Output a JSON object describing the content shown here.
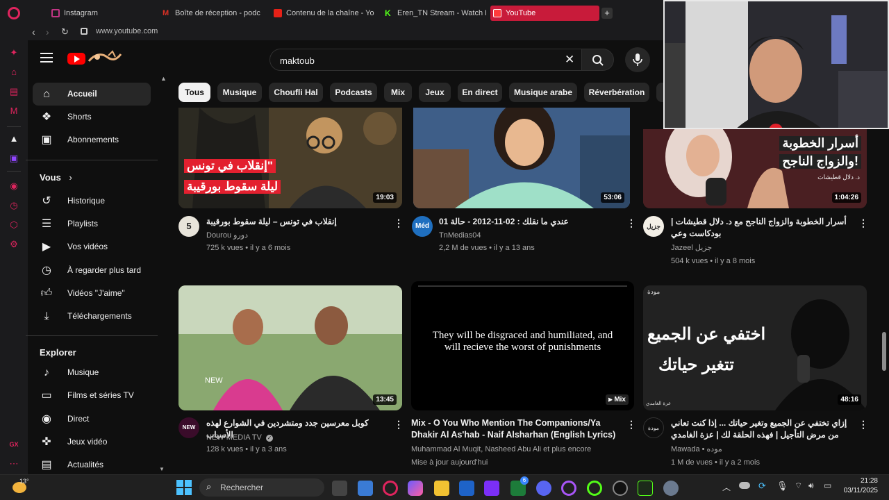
{
  "browser": {
    "tabs": [
      {
        "label": "Instagram",
        "color": "#c13584"
      },
      {
        "label": "Boîte de réception - podc",
        "color": "#d93025"
      },
      {
        "label": "Contenu de la chaîne - Yo",
        "color": "#e62117"
      },
      {
        "label": "Eren_TN Stream - Watch L",
        "color": "#53fc18"
      },
      {
        "label": "YouTube",
        "color": "#ff0000"
      }
    ],
    "new_tab_label": "+",
    "url": "www.youtube.com"
  },
  "search": {
    "value": "maktoub"
  },
  "chips": [
    "Tous",
    "Musique",
    "Choufli Hal",
    "Podcasts",
    "Mix",
    "Jeux",
    "En direct",
    "Musique arabe",
    "Réverbération"
  ],
  "sidebar": {
    "main": [
      {
        "label": "Accueil",
        "icon": "home-icon"
      },
      {
        "label": "Shorts",
        "icon": "shorts-icon"
      },
      {
        "label": "Abonnements",
        "icon": "subscriptions-icon"
      }
    ],
    "you_title": "Vous",
    "you": [
      {
        "label": "Historique",
        "icon": "history-icon"
      },
      {
        "label": "Playlists",
        "icon": "playlists-icon"
      },
      {
        "label": "Vos vidéos",
        "icon": "your-videos-icon"
      },
      {
        "label": "À regarder plus tard",
        "icon": "watch-later-icon"
      },
      {
        "label": "Vidéos \"J'aime\"",
        "icon": "liked-icon"
      },
      {
        "label": "Téléchargements",
        "icon": "downloads-icon"
      }
    ],
    "explore_title": "Explorer",
    "explore": [
      {
        "label": "Musique",
        "icon": "music-icon"
      },
      {
        "label": "Films et séries TV",
        "icon": "movies-icon"
      },
      {
        "label": "Direct",
        "icon": "live-icon"
      },
      {
        "label": "Jeux vidéo",
        "icon": "gaming-icon"
      },
      {
        "label": "Actualités",
        "icon": "news-icon"
      }
    ]
  },
  "videos": [
    {
      "title": "إنقلاب في تونس – ليلة سقوط بورقيبة",
      "channel": "Dourou دورو",
      "meta": "725 k vues • il y a 6 mois",
      "duration": "19:03",
      "thumb_text_1": "\"إنقلاب في تونس",
      "thumb_text_2": "ليلة سقوط بورقيبة",
      "avatar_text": "5"
    },
    {
      "title": "عندي ما نقلك : 02-11-2012 - حالة 01",
      "channel": "TnMedias04",
      "meta": "2,2 M de vues • il y a 13 ans",
      "duration": "53:06",
      "avatar_text": "Méd"
    },
    {
      "title": "أسرار الخطوبة والزواج الناجح مع  د. دلال قطيشات | بودكاست وعي",
      "channel": "Jazeel جزيل",
      "meta": "504 k vues • il y a 8 mois",
      "duration": "1:04:26",
      "thumb_text_1": "أسرار الخطوبة",
      "thumb_text_2": "والزواج الناجح!",
      "thumb_text_3": "د. دلال قطيشات",
      "avatar_text": "جزيل"
    },
    {
      "title": "كوبل معرسين جدد ومتشردين في الشوارع  لهذه الأسباب",
      "channel": "NEW MEDIA TV",
      "meta": "128 k vues • il y a 3 ans",
      "duration": "13:45",
      "badge": "NEW",
      "avatar_text": "NEW"
    },
    {
      "title": "Mix - O You Who Mention The Companions/Ya Dhakir Al As'hab - Naif Alsharhan (English Lyrics)",
      "channel": "Muhammad Al Muqit, Nasheed Abu Ali et plus encore",
      "meta": "Mise à jour aujourd'hui",
      "duration": "Mix",
      "thumb_text_1": "They will be disgraced and humiliated, and will recieve the worst of punishments"
    },
    {
      "title": "إزاي تختفي عن الجميع وتغير حياتك ... إذا كنت تعاني من مرض التأجيل | فهذه الحلقة لك | عزة الغامدي",
      "channel": "Mawada • موده",
      "meta": "1 M de vues • il y a 2 mois",
      "duration": "48:16",
      "thumb_text_1": "اختفي عن الجميع",
      "thumb_text_2": "تتغير حياتك",
      "thumb_text_3": "عزة الغامدي",
      "thumb_text_4": "مودة",
      "avatar_text": "مودة"
    }
  ],
  "taskbar": {
    "weather": "13°",
    "search_placeholder": "Rechercher",
    "time": "21:28",
    "date": "03/11/2025",
    "badge": "6"
  }
}
